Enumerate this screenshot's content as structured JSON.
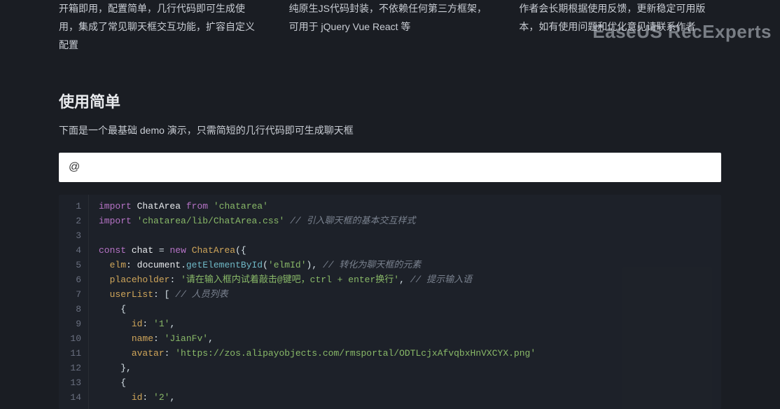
{
  "watermark": "EaseUS RecExperts",
  "features": [
    "开箱即用，配置简单，几行代码即可生成使用，集成了常见聊天框交互功能，扩容自定义配置",
    "纯原生JS代码封装，不依赖任何第三方框架，可用于 jQuery Vue React 等",
    "作者会长期根据使用反馈，更新稳定可用版本，如有使用问题和优化意见请联系作者"
  ],
  "section": {
    "title": "使用简单",
    "desc": "下面是一个最基础 demo 演示，只需简短的几行代码即可生成聊天框"
  },
  "demo_input": "@",
  "code": {
    "line_count": 14,
    "tokens": {
      "l1_import": "import",
      "l1_ChatArea": "ChatArea",
      "l1_from": "from",
      "l1_str": "'chatarea'",
      "l2_import": "import",
      "l2_str": "'chatarea/lib/ChatArea.css'",
      "l2_comment": "// 引入聊天框的基本交互样式",
      "l4_const": "const",
      "l4_chat": "chat",
      "l4_eq": "=",
      "l4_new": "new",
      "l4_ChatArea": "ChatArea",
      "l4_open": "({",
      "l5_prop": "elm",
      "l5_doc": "document",
      "l5_fn": "getElementById",
      "l5_arg": "'elmId'",
      "l5_comment": "// 转化为聊天框的元素",
      "l6_prop": "placeholder",
      "l6_str": "'请在输入框内试着敲击@键吧，ctrl + enter换行'",
      "l6_comment": "// 提示输入语",
      "l7_prop": "userList",
      "l7_open": "[",
      "l7_comment": "// 人员列表",
      "l8_open": "{",
      "l9_prop": "id",
      "l9_val": "'1'",
      "l10_prop": "name",
      "l10_val": "'JianFv'",
      "l11_prop": "avatar",
      "l11_val": "'https://zos.alipayobjects.com/rmsportal/ODTLcjxAfvqbxHnVXCYX.png'",
      "l12_close": "},",
      "l13_open": "{",
      "l14_prop": "id",
      "l14_val": "'2'"
    }
  }
}
